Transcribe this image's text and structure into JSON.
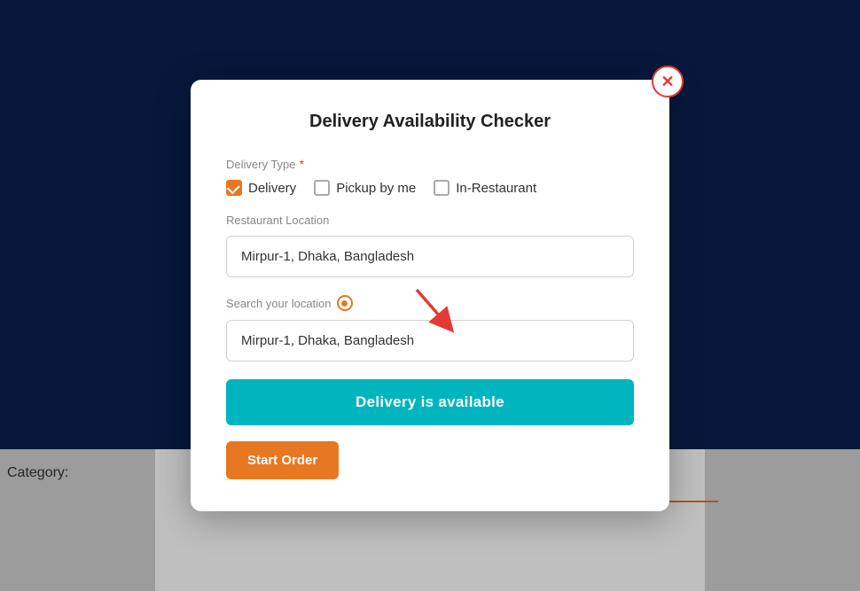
{
  "background": {
    "category_label": "Category:"
  },
  "modal": {
    "title": "Delivery Availability Checker",
    "close_icon": "✕",
    "delivery_type_label": "Delivery Type",
    "required_marker": "*",
    "options": [
      {
        "label": "Delivery",
        "checked": true
      },
      {
        "label": "Pickup by me",
        "checked": false
      },
      {
        "label": "In-Restaurant",
        "checked": false
      }
    ],
    "restaurant_location_label": "Restaurant Location",
    "restaurant_location_value": "Mirpur-1, Dhaka, Bangladesh",
    "search_location_label": "Search your location",
    "search_location_value": "Mirpur-1, Dhaka, Bangladesh",
    "delivery_status_button": "Delivery is available",
    "start_order_button": "Start Order"
  }
}
